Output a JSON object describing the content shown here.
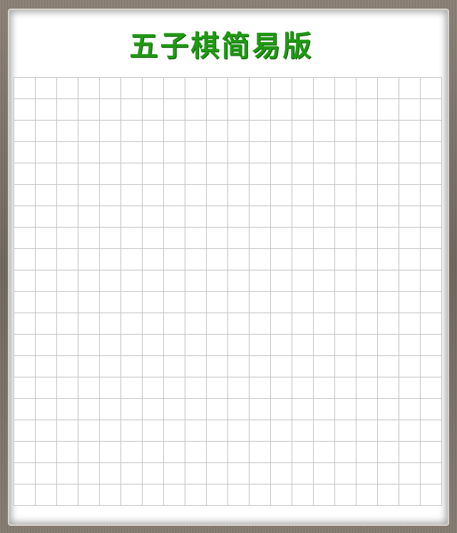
{
  "title": "五子棋简易版",
  "board": {
    "columns": 20,
    "rows": 20,
    "stones": [],
    "line_color": "#c4c4c4",
    "background_color": "#ffffff"
  },
  "colors": {
    "title": "#1f9a13",
    "frame": "#7a7065"
  }
}
